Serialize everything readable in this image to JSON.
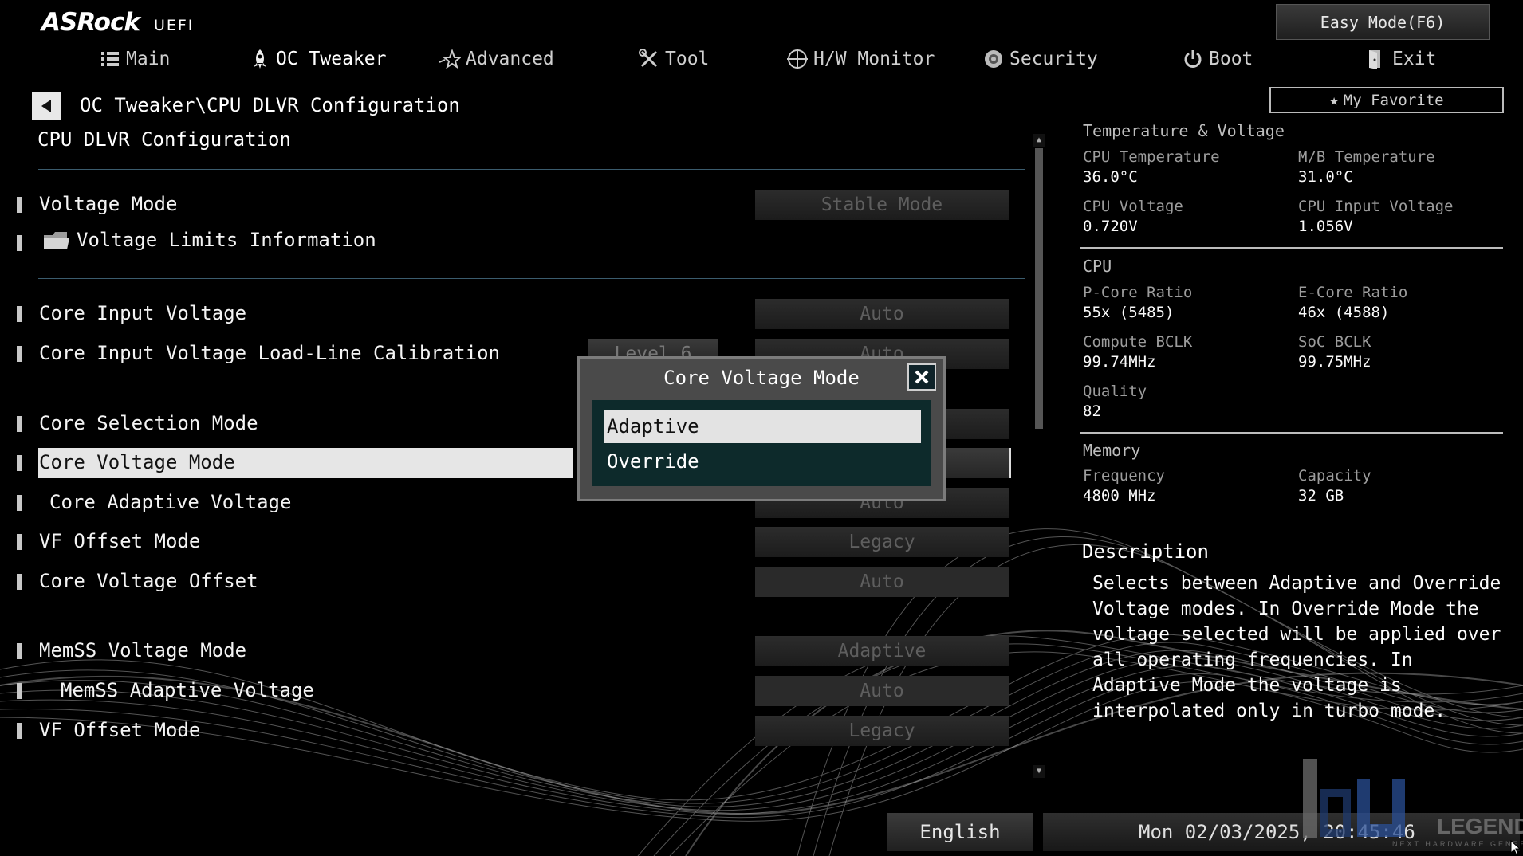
{
  "header": {
    "brand": "ASRock",
    "brand_sub": "UEFI",
    "easy_mode": "Easy Mode(F6)",
    "my_favorite": "My Favorite",
    "tabs": [
      {
        "label": "Main",
        "icon": "list-icon"
      },
      {
        "label": "OC Tweaker",
        "icon": "rocket-icon",
        "active": true
      },
      {
        "label": "Advanced",
        "icon": "star-icon"
      },
      {
        "label": "Tool",
        "icon": "tools-icon"
      },
      {
        "label": "H/W Monitor",
        "icon": "monitor-icon"
      },
      {
        "label": "Security",
        "icon": "shield-icon"
      },
      {
        "label": "Boot",
        "icon": "power-icon"
      },
      {
        "label": "Exit",
        "icon": "exit-icon"
      }
    ]
  },
  "breadcrumb": "OC Tweaker\\CPU DLVR Configuration",
  "page_title": "CPU DLVR Configuration",
  "settings": [
    {
      "label": "Voltage Mode",
      "value": "Stable Mode"
    },
    {
      "label": "Voltage Limits Information",
      "value": ""
    },
    {
      "label": "Core Input Voltage",
      "value": "Auto"
    },
    {
      "label": "Core Input Voltage Load-Line Calibration",
      "value": "Auto",
      "extra": "Level 6"
    },
    {
      "label": "Core Selection Mode",
      "value": ""
    },
    {
      "label": "Core Voltage Mode",
      "value": ""
    },
    {
      "label": "Core Adaptive Voltage",
      "value": "Auto"
    },
    {
      "label": "VF Offset Mode",
      "value": "Legacy"
    },
    {
      "label": "Core Voltage Offset",
      "value": "Auto"
    },
    {
      "label": "MemSS Voltage Mode",
      "value": "Adaptive"
    },
    {
      "label": "MemSS Adaptive Voltage",
      "value": "Auto"
    },
    {
      "label": "VF Offset Mode",
      "value": "Legacy"
    }
  ],
  "dialog": {
    "title": "Core Voltage Mode",
    "options": [
      "Adaptive",
      "Override"
    ],
    "selected": "Adaptive"
  },
  "monitor": {
    "title": "Temperature & Voltage",
    "cpu_temp_label": "CPU Temperature",
    "cpu_temp": "36.0°C",
    "mb_temp_label": "M/B Temperature",
    "mb_temp": "31.0°C",
    "cpu_volt_label": "CPU Voltage",
    "cpu_volt": "0.720V",
    "cpu_input_label": "CPU Input Voltage",
    "cpu_input": "1.056V",
    "cpu_title": "CPU",
    "pcore_label": "P-Core Ratio",
    "pcore": "55x (5485)",
    "ecore_label": "E-Core Ratio",
    "ecore": "46x (4588)",
    "compute_label": "Compute BCLK",
    "compute": "99.74MHz",
    "soc_label": "SoC BCLK",
    "soc": "99.75MHz",
    "quality_label": "Quality",
    "quality": "82",
    "memory_title": "Memory",
    "freq_label": "Frequency",
    "freq": "4800 MHz",
    "cap_label": "Capacity",
    "cap": "32 GB"
  },
  "description": {
    "title": "Description",
    "text": "Selects between Adaptive and Override Voltage modes. In Override Mode the voltage selected will be applied over all operating frequencies. In Adaptive Mode the voltage is interpolated only in turbo mode."
  },
  "footer": {
    "language": "English",
    "datetime": "Mon 02/03/2025, 20:45:46"
  },
  "watermark": {
    "text": "LEGEND",
    "subtext": "NEXT HARDWARE GENERATION"
  },
  "colors": {
    "accent_line": "#3b5c6e",
    "dialog_list_bg": "#0d2a2b",
    "highlight": "#e6e6e6"
  }
}
